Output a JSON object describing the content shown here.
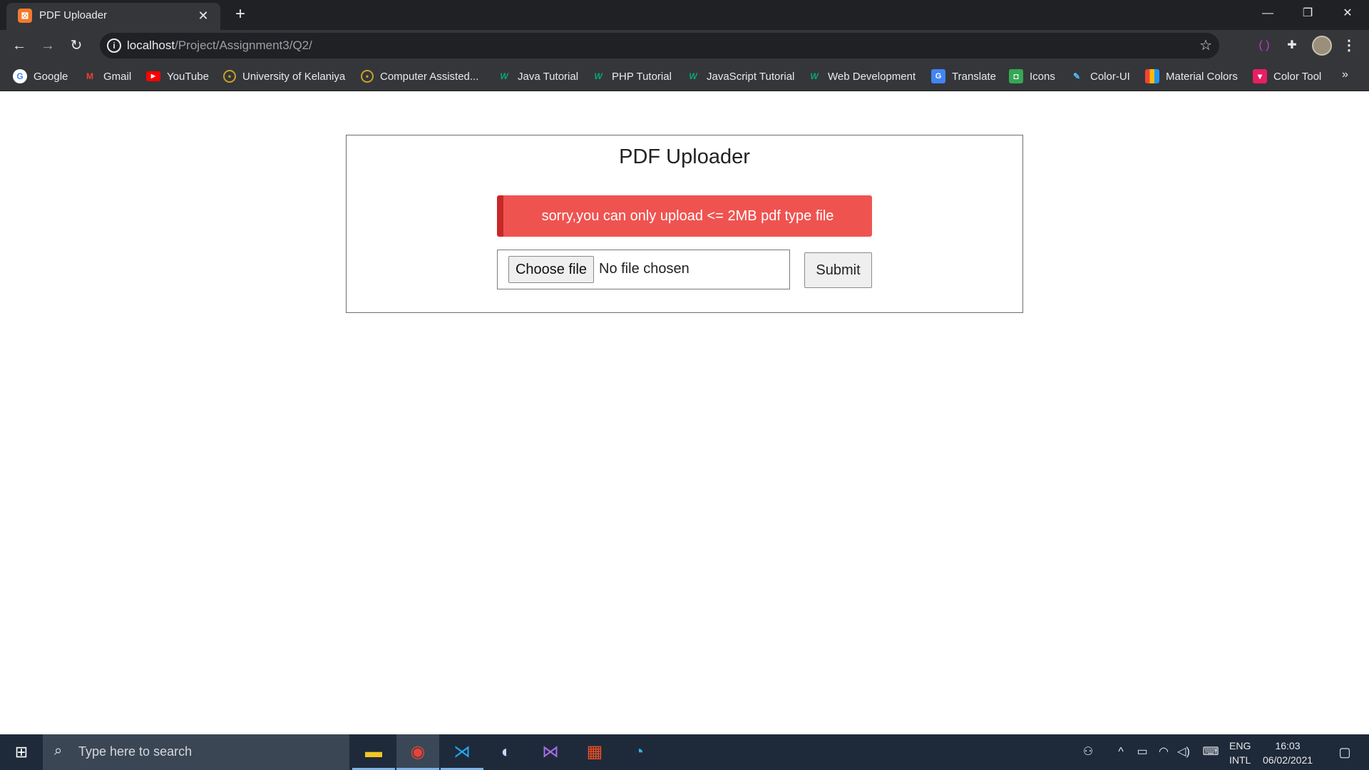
{
  "browser": {
    "tab": {
      "title": "PDF Uploader",
      "close": "✕"
    },
    "new_tab": "+",
    "window": {
      "minimize": "—",
      "restore": "❐",
      "close": "✕"
    },
    "url": {
      "host": "localhost",
      "path": "/Project/Assignment3/Q2/"
    },
    "bookmarks": [
      {
        "label": "Google",
        "icon": "google-icon",
        "color": "#4285f4"
      },
      {
        "label": "Gmail",
        "icon": "gmail-icon",
        "color": "#ea4335"
      },
      {
        "label": "YouTube",
        "icon": "youtube-icon",
        "color": "#ff0000"
      },
      {
        "label": "University of Kelaniya",
        "icon": "university-icon",
        "color": "#c9a227"
      },
      {
        "label": "Computer Assisted...",
        "icon": "university-icon",
        "color": "#c9a227"
      },
      {
        "label": "Java Tutorial",
        "icon": "w3schools-icon",
        "color": "#04aa6d"
      },
      {
        "label": "PHP Tutorial",
        "icon": "w3schools-icon",
        "color": "#04aa6d"
      },
      {
        "label": "JavaScript Tutorial",
        "icon": "w3schools-icon",
        "color": "#04aa6d"
      },
      {
        "label": "Web Development",
        "icon": "w3schools-icon",
        "color": "#04aa6d"
      },
      {
        "label": "Translate",
        "icon": "translate-icon",
        "color": "#4285f4"
      },
      {
        "label": "Icons",
        "icon": "icons-icon",
        "color": "#34a853"
      },
      {
        "label": "Color-UI",
        "icon": "color-ui-icon",
        "color": "#4fc3f7"
      },
      {
        "label": "Material Colors",
        "icon": "material-colors-icon",
        "color": "#fbbc05"
      },
      {
        "label": "Color Tool",
        "icon": "color-tool-icon",
        "color": "#e91e63"
      }
    ],
    "bookmarks_more": "»"
  },
  "page": {
    "title": "PDF Uploader",
    "alert": "sorry,you can only upload <= 2MB pdf type file",
    "choose_file": "Choose file",
    "no_file": "No file chosen",
    "submit": "Submit"
  },
  "taskbar": {
    "search_placeholder": "Type here to search",
    "lang_top": "ENG",
    "lang_bottom": "INTL",
    "time": "16:03",
    "date": "06/02/2021"
  },
  "colors": {
    "alert_bg": "#ef5350",
    "alert_border": "#c62828",
    "chrome_dark": "#202124",
    "chrome_toolbar": "#35363a"
  }
}
